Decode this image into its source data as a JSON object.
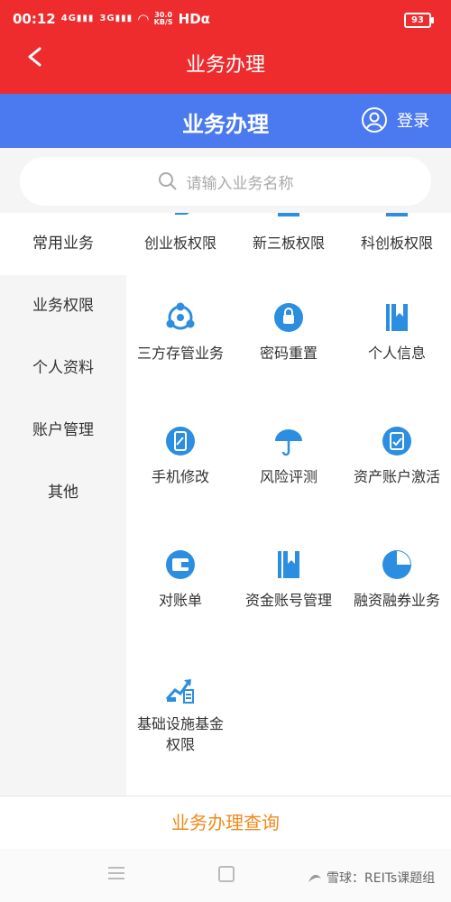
{
  "status_bar": {
    "time": "00:12",
    "signal1": "4G",
    "signal2": "3G",
    "speed_value": "30.0",
    "speed_unit": "KB/S",
    "hd": "HDα",
    "battery": "93"
  },
  "app_header": {
    "title": "业务办理"
  },
  "page_header": {
    "title": "业务办理",
    "login_label": "登录"
  },
  "search": {
    "placeholder": "请输入业务名称"
  },
  "sidebar": {
    "items": [
      {
        "label": "常用业务",
        "active": true
      },
      {
        "label": "业务权限",
        "active": false
      },
      {
        "label": "个人资料",
        "active": false
      },
      {
        "label": "账户管理",
        "active": false
      },
      {
        "label": "其他",
        "active": false
      }
    ]
  },
  "services": [
    {
      "label": "创业板权限",
      "icon": "chuangye-icon"
    },
    {
      "label": "新三板权限",
      "icon": "xinsanban-icon"
    },
    {
      "label": "科创板权限",
      "icon": "kechuang-icon"
    },
    {
      "label": "三方存管业务",
      "icon": "third-party-custody-icon"
    },
    {
      "label": "密码重置",
      "icon": "password-reset-icon"
    },
    {
      "label": "个人信息",
      "icon": "personal-info-icon"
    },
    {
      "label": "手机修改",
      "icon": "phone-edit-icon"
    },
    {
      "label": "风险评测",
      "icon": "umbrella-icon"
    },
    {
      "label": "资产账户激活",
      "icon": "account-activate-icon"
    },
    {
      "label": "对账单",
      "icon": "wallet-icon"
    },
    {
      "label": "资金账号管理",
      "icon": "bookmark-icon"
    },
    {
      "label": "融资融券业务",
      "icon": "pie-chart-icon"
    },
    {
      "label": "基础设施基金权限",
      "icon": "growth-chart-icon"
    }
  ],
  "bottom": {
    "query_label": "业务办理查询"
  },
  "watermark": {
    "text": "雪球：REITs课题组"
  },
  "colors": {
    "red": "#ee2b2d",
    "blue_header": "#4a79f0",
    "icon_blue": "#2c8ee0",
    "query_orange": "#f08a1a"
  }
}
